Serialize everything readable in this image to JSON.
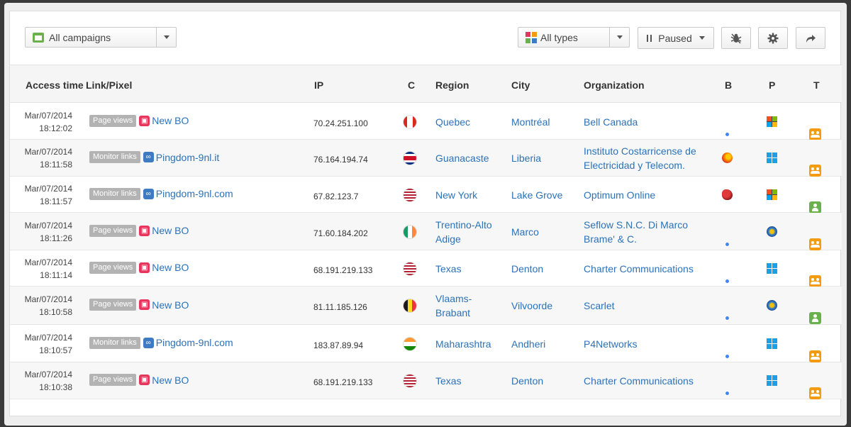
{
  "toolbar": {
    "campaign_select": "All campaigns",
    "type_select": "All types",
    "status_button": "Paused",
    "icons": [
      "folder-icon",
      "grid-icon",
      "bug-icon",
      "gear-icon",
      "share-icon"
    ]
  },
  "table": {
    "headers": {
      "access_time": "Access time",
      "link_pixel": "Link/Pixel",
      "ip": "IP",
      "country": "C",
      "region": "Region",
      "city": "City",
      "organization": "Organization",
      "browser": "B",
      "platform": "P",
      "type": "T"
    },
    "rows": [
      {
        "date": "Mar/07/2014",
        "time": "18:12:02",
        "kind": "Page views",
        "link": "New BO",
        "ip": "70.24.251.100",
        "flag": "ca",
        "region": [
          "Quebec"
        ],
        "city": [
          "Montréal"
        ],
        "org": [
          "Bell Canada"
        ],
        "browser": "chrome",
        "platform": "windows-old",
        "type": "group"
      },
      {
        "date": "Mar/07/2014",
        "time": "18:11:58",
        "kind": "Monitor links",
        "link": "Pingdom-9nl.it",
        "ip": "76.164.194.74",
        "flag": "cr",
        "region": [
          "Guanacaste"
        ],
        "city": [
          "Liberia"
        ],
        "org": [
          "Instituto Costarricense de",
          "Electricidad y Telecom."
        ],
        "browser": "firefox",
        "platform": "windows-8",
        "type": "group"
      },
      {
        "date": "Mar/07/2014",
        "time": "18:11:57",
        "kind": "Monitor links",
        "link": "Pingdom-9nl.com",
        "ip": "67.82.123.7",
        "flag": "us",
        "region": [
          "New York"
        ],
        "city": [
          "Lake Grove"
        ],
        "org": [
          "Optimum Online"
        ],
        "browser": "bot",
        "platform": "windows-old",
        "type": "single"
      },
      {
        "date": "Mar/07/2014",
        "time": "18:11:26",
        "kind": "Page views",
        "link": "New BO",
        "ip": "71.60.184.202",
        "flag": "ie",
        "region": [
          "Trentino-Alto",
          "Adige"
        ],
        "city": [
          "Marco"
        ],
        "org": [
          "Seflow S.N.C. Di Marco",
          "Brame' & C."
        ],
        "browser": "chrome",
        "platform": "windows-vista",
        "type": "group"
      },
      {
        "date": "Mar/07/2014",
        "time": "18:11:14",
        "kind": "Page views",
        "link": "New BO",
        "ip": "68.191.219.133",
        "flag": "us",
        "region": [
          "Texas"
        ],
        "city": [
          "Denton"
        ],
        "org": [
          "Charter Communications"
        ],
        "browser": "chrome",
        "platform": "windows-8",
        "type": "group"
      },
      {
        "date": "Mar/07/2014",
        "time": "18:10:58",
        "kind": "Page views",
        "link": "New BO",
        "ip": "81.11.185.126",
        "flag": "be",
        "region": [
          "Vlaams-",
          "Brabant"
        ],
        "city": [
          "Vilvoorde"
        ],
        "org": [
          "Scarlet"
        ],
        "browser": "chrome",
        "platform": "windows-7",
        "type": "single"
      },
      {
        "date": "Mar/07/2014",
        "time": "18:10:57",
        "kind": "Monitor links",
        "link": "Pingdom-9nl.com",
        "ip": "183.87.89.94",
        "flag": "in",
        "region": [
          "Maharashtra"
        ],
        "city": [
          "Andheri"
        ],
        "org": [
          "P4Networks"
        ],
        "browser": "chrome",
        "platform": "windows-8",
        "type": "group"
      },
      {
        "date": "Mar/07/2014",
        "time": "18:10:38",
        "kind": "Page views",
        "link": "New BO",
        "ip": "68.191.219.133",
        "flag": "us",
        "region": [
          "Texas"
        ],
        "city": [
          "Denton"
        ],
        "org": [
          "Charter Communications"
        ],
        "browser": "chrome",
        "platform": "windows-8",
        "type": "group"
      }
    ]
  },
  "colors": {
    "link": "#2b72b9",
    "page_views_icon": "#e8355c",
    "monitor_links_icon": "#3d7bc4",
    "badge": "#b3b3b3",
    "type_group": "#f39c12",
    "type_single": "#6ab04c"
  }
}
